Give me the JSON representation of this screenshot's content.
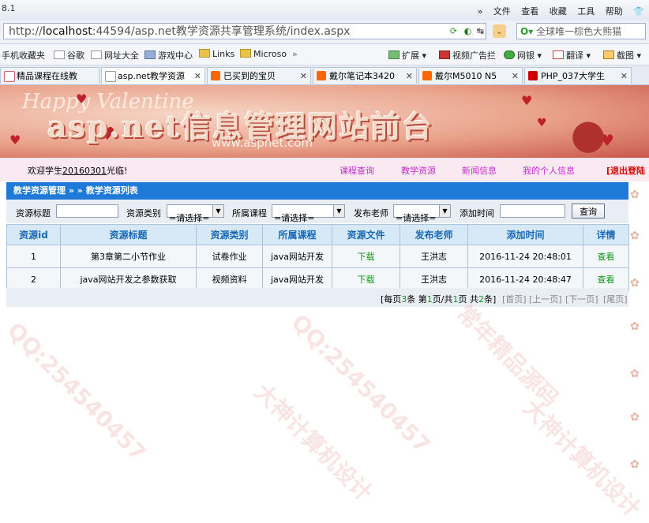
{
  "browser": {
    "version": "8.1",
    "menus": [
      "»",
      "文件",
      "查看",
      "收藏",
      "工具",
      "帮助"
    ],
    "url_prefix": "http://",
    "url_host": "localhost",
    "url_rest": ":44594/asp.net教学资源共享管理系统/index.aspx",
    "search_placeholder": "全球唯一棕色大熊猫",
    "favorites": [
      "手机收藏夹",
      "谷歌",
      "网址大全",
      "游戏中心",
      "Links",
      "Microso",
      "»"
    ],
    "fav_right": [
      "扩展",
      "视频广告拦",
      "网银",
      "翻译",
      "截图"
    ],
    "tabs": [
      {
        "label": "精品课程在线教"
      },
      {
        "label": "asp.net教学资源"
      },
      {
        "label": "已买到的宝贝"
      },
      {
        "label": "戴尔笔记本3420"
      },
      {
        "label": "戴尔M5010 N5"
      },
      {
        "label": "PHP_037大学生"
      }
    ]
  },
  "banner": {
    "title": "asp.net信息管理网站前台",
    "url": "www.aspnet.com",
    "deco": "Happy Valentine"
  },
  "nav": {
    "welcome_prefix": "欢迎学生",
    "student_id": "20160301",
    "welcome_suffix": "光临!",
    "links": [
      "课程查询",
      "教学资源",
      "新闻信息",
      "我的个人信息"
    ],
    "logout": "[退出登陆"
  },
  "panel": {
    "breadcrumb": "教学资源管理 » » 教学资源列表"
  },
  "filter": {
    "title_label": "资源标题",
    "type_label": "资源类别",
    "type_value": "=请选择=",
    "course_label": "所属课程",
    "course_value": "=请选择=",
    "teacher_label": "发布老师",
    "teacher_value": "=请选择=",
    "time_label": "添加时间",
    "search_button": "查询"
  },
  "table": {
    "headers": [
      "资源id",
      "资源标题",
      "资源类别",
      "所属课程",
      "资源文件",
      "发布老师",
      "添加时间",
      "详情"
    ],
    "rows": [
      {
        "id": "1",
        "title": "第3章第二小节作业",
        "type": "试卷作业",
        "course": "java网站开发",
        "file": "下载",
        "teacher": "王洪志",
        "time": "2016-11-24 20:48:01",
        "detail": "查看"
      },
      {
        "id": "2",
        "title": "java网站开发之参数获取",
        "type": "视频资料",
        "course": "java网站开发",
        "file": "下载",
        "teacher": "王洪志",
        "time": "2016-11-24 20:48:47",
        "detail": "查看"
      }
    ]
  },
  "pager": {
    "per_page_prefix": "[每页",
    "per_page": "3",
    "per_page_suffix": "条 第",
    "current_page": "1",
    "mid": "页/共",
    "total_pages": "1",
    "mid2": "页 共",
    "total_records": "2",
    "suffix": "条]",
    "first": "[首页]",
    "prev": "[上一页]",
    "next": "[下一页]",
    "last": "[尾页]"
  },
  "watermarks": [
    "QQ:254540457",
    "大神计算机设计",
    "常年精品源码"
  ],
  "colors": {
    "accent": "#1f79d6",
    "nav_link": "#c62bd4",
    "green": "#0f9a1a",
    "logout": "#d80000"
  }
}
